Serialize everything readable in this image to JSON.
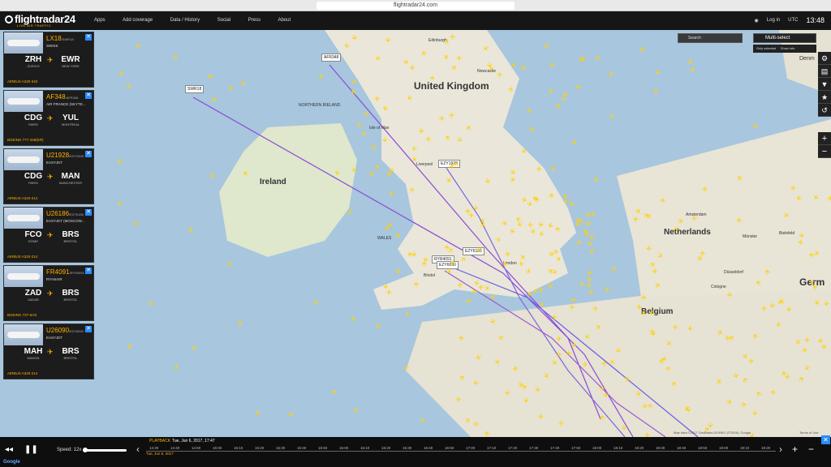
{
  "browser": {
    "url": "flightradar24.com"
  },
  "header": {
    "logo": "flightradar24",
    "tagline": "LIVE AIR TRAFFIC",
    "nav": [
      "Apps",
      "Add coverage",
      "Data / History",
      "Social",
      "Press",
      "About"
    ],
    "login": "Log in",
    "utc": "UTC",
    "time": "13:48"
  },
  "flights": [
    {
      "number": "LX18",
      "reg": "/SWR18",
      "airline": "SWISS",
      "from": "ZRH",
      "from_city": "ZURICH",
      "to": "EWR",
      "to_city": "NEW YORK",
      "aircraft": "AIRBUS A330-343"
    },
    {
      "number": "AF348",
      "reg": "/AFR348",
      "airline": "AIR FRANCE (SKYTE...",
      "from": "CDG",
      "from_city": "PARIS",
      "to": "YUL",
      "to_city": "MONTREAL",
      "aircraft": "BOEING 777-328(ER)"
    },
    {
      "number": "U21928",
      "reg": "/EZY1928",
      "airline": "EASYJET",
      "from": "CDG",
      "from_city": "PARIS",
      "to": "MAN",
      "to_city": "MANCHESTER",
      "aircraft": "AIRBUS A320-214"
    },
    {
      "number": "U26186",
      "reg": "/EZY6186",
      "airline": "EASYJET (MOSCOW...",
      "from": "FCO",
      "from_city": "ROME",
      "to": "BRS",
      "to_city": "BRISTOL",
      "aircraft": "AIRBUS A320-214"
    },
    {
      "number": "FR4091",
      "reg": "/RYR4091",
      "airline": "RYANAIR",
      "from": "ZAD",
      "from_city": "ZADAR",
      "to": "BRS",
      "to_city": "BRISTOL",
      "aircraft": "BOEING 737-8AS"
    },
    {
      "number": "U26090",
      "reg": "/EZY6090",
      "airline": "EASYJET",
      "from": "MAH",
      "from_city": "MAHON",
      "to": "BRS",
      "to_city": "BRISTOL",
      "aircraft": "AIRBUS A320-214"
    }
  ],
  "map": {
    "search_placeholder": "Search",
    "multiselect": "Multi-select",
    "only_selected": "Only selected",
    "show_info": "Show info",
    "countries": {
      "uk": "United Kingdom",
      "ireland": "Ireland",
      "wales": "WALES",
      "netherlands": "Netherlands",
      "belgium": "Belgium",
      "germany": "Germ",
      "denmark": "Denm",
      "northern_ireland": "NORTHERN IRELAND",
      "isle": "Isle of Man"
    },
    "cities": {
      "liverpool": "Liverpool",
      "bristol": "Bristol",
      "london": "London",
      "amsterdam": "Amsterdam",
      "cologne": "Cologne",
      "dusseldorf": "Düsseldorf",
      "munster": "Münster",
      "bielefeld": "Bielefeld",
      "edinburgh": "Edinburgh",
      "newcastle": "Newcastle"
    },
    "labels": {
      "swr18": "SWR18",
      "afr348": "AFR348",
      "ezy1928": "EZY1928",
      "ezy6186": "EZY6186",
      "ryr4091": "RYR4091",
      "ezy6090": "EZY6090"
    },
    "attribution": "Map data ©2017 GeoBasis-DE/BKG (©2009), Google",
    "terms": "Terms of Use"
  },
  "playback": {
    "label": "PLAYBACK",
    "datetime": "Tue, Jun 6, 2017, 17:47",
    "start_label": "Tue, Jun 6, 2017",
    "speed_label": "Speed: 12x",
    "speed": 0.03,
    "ticks": [
      "14:30",
      "14:40",
      "14:50",
      "15:00",
      "15:10",
      "15:20",
      "15:30",
      "15:40",
      "15:50",
      "16:00",
      "16:10",
      "16:20",
      "16:30",
      "16:40",
      "16:50",
      "17:00",
      "17:10",
      "17:20",
      "17:30",
      "17:40",
      "17:50",
      "18:00",
      "18:10",
      "18:20",
      "18:30",
      "18:40",
      "18:50",
      "19:00",
      "19:10",
      "19:20"
    ]
  },
  "icons": {
    "rewind": "rewind-icon",
    "pause": "pause-icon",
    "plus": "plus-icon",
    "minus": "minus-icon",
    "close": "close-icon"
  },
  "colors": {
    "accent": "#ffb000",
    "plane": "#ffd200",
    "close": "#2a8cff",
    "track": "#8a4bd6"
  }
}
